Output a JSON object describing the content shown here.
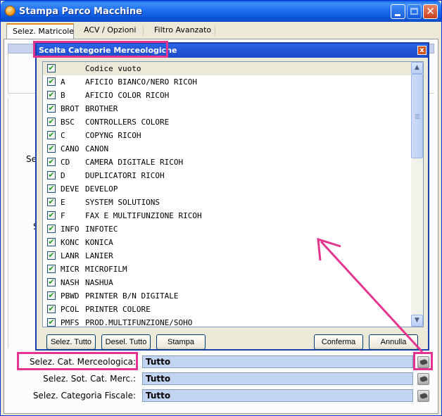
{
  "window": {
    "title": "Stampa Parco Macchine",
    "close_glyph": "✕"
  },
  "tabs": [
    {
      "label": "Selez. Matricole"
    },
    {
      "label": "ACV / Opzioni"
    },
    {
      "label": "Filtro Avanzato"
    }
  ],
  "background_labels": [
    "Se",
    "S"
  ],
  "dialog": {
    "title": "Scelta Categorie Merceologiche",
    "close_glyph": "x",
    "header_row": {
      "code": "",
      "desc": "Codice vuoto",
      "checked": true
    },
    "items": [
      {
        "code": "A",
        "desc": "AFICIO BIANCO/NERO RICOH",
        "checked": true
      },
      {
        "code": "B",
        "desc": "AFICIO COLOR RICOH",
        "checked": true
      },
      {
        "code": "BROT",
        "desc": "BROTHER",
        "checked": true
      },
      {
        "code": "BSC",
        "desc": "CONTROLLERS COLORE",
        "checked": true
      },
      {
        "code": "C",
        "desc": "COPYNG RICOH",
        "checked": true
      },
      {
        "code": "CANO",
        "desc": "CANON",
        "checked": true
      },
      {
        "code": "CD",
        "desc": "CAMERA DIGITALE RICOH",
        "checked": true
      },
      {
        "code": "D",
        "desc": "DUPLICATORI RICOH",
        "checked": true
      },
      {
        "code": "DEVE",
        "desc": "DEVELOP",
        "checked": true
      },
      {
        "code": "E",
        "desc": "SYSTEM SOLUTIONS",
        "checked": true
      },
      {
        "code": "F",
        "desc": "FAX E MULTIFUNZIONE RICOH",
        "checked": true
      },
      {
        "code": "INFO",
        "desc": "INFOTEC",
        "checked": true
      },
      {
        "code": "KONC",
        "desc": "KONICA",
        "checked": true
      },
      {
        "code": "LANR",
        "desc": "LANIER",
        "checked": true
      },
      {
        "code": "MICR",
        "desc": "MICROFILM",
        "checked": true
      },
      {
        "code": "NASH",
        "desc": "NASHUA",
        "checked": true
      },
      {
        "code": "PBWD",
        "desc": "PRINTER B/N DIGITALE",
        "checked": true
      },
      {
        "code": "PCOL",
        "desc": "PRINTER COLORE",
        "checked": true
      },
      {
        "code": "PMFS",
        "desc": "PROD.MULTIFUNZIONE/SOHO",
        "checked": true
      }
    ],
    "check_glyph": "✔",
    "scroll_up_glyph": "▲",
    "scroll_down_glyph": "▼",
    "buttons": {
      "select_all": "Selez. Tutto",
      "deselect_all": "Desel. Tutto",
      "print": "Stampa",
      "confirm": "Conferma",
      "cancel": "Annulla"
    }
  },
  "fields": [
    {
      "label": "Selez. Cat. Merceologica:",
      "value": "Tutto"
    },
    {
      "label": "Selez. Sot. Cat. Merc.:",
      "value": "Tutto"
    },
    {
      "label": "Selez. Categoria Fiscale:",
      "value": "Tutto"
    }
  ],
  "colors": {
    "annotation": "#e5348f",
    "titlebar": "#0a56d8",
    "field_bg": "#c1d4f2"
  }
}
